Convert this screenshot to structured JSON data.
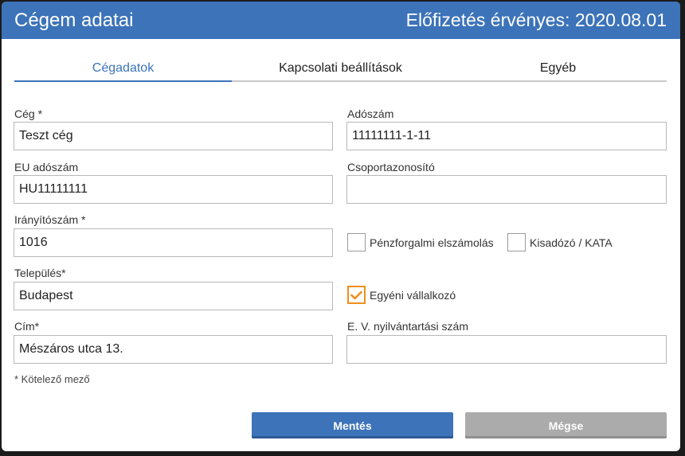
{
  "header": {
    "title": "Cégem adatai",
    "subscription": "Előfizetés érvényes: 2020.08.01"
  },
  "tabs": [
    {
      "label": "Cégadatok",
      "active": true
    },
    {
      "label": "Kapcsolati beállítások",
      "active": false
    },
    {
      "label": "Egyéb",
      "active": false
    }
  ],
  "form": {
    "company": {
      "label": "Cég *",
      "value": "Teszt cég"
    },
    "tax_number": {
      "label": "Adószám",
      "value": "11111111-1-11"
    },
    "eu_tax_number": {
      "label": "EU adószám",
      "value": "HU11111111"
    },
    "group_id": {
      "label": "Csoportazonosító",
      "value": ""
    },
    "zip": {
      "label": "Irányítószám *",
      "value": "1016"
    },
    "city": {
      "label": "Település*",
      "value": "Budapest"
    },
    "address": {
      "label": "Cím*",
      "value": "Mészáros utca 13."
    },
    "ev_number": {
      "label": "E. V. nyilvántartási szám",
      "value": ""
    },
    "cash_accounting": {
      "label": "Pénzforgalmi elszámolás",
      "checked": false
    },
    "kata": {
      "label": "Kisadózó / KATA",
      "checked": false
    },
    "sole_trader": {
      "label": "Egyéni vállalkozó",
      "checked": true
    }
  },
  "required_note": "* Kötelező mező",
  "buttons": {
    "save": "Mentés",
    "cancel": "Mégse"
  },
  "colors": {
    "accent": "#3c73b9",
    "checkbox_checked": "#ef8f1c",
    "cancel_button": "#ababab"
  }
}
